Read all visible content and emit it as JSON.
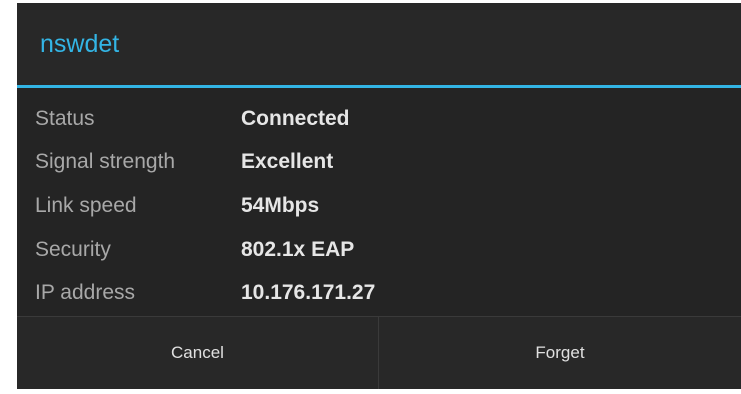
{
  "dialog": {
    "title": "nswdet",
    "details": [
      {
        "label": "Status",
        "value": "Connected"
      },
      {
        "label": "Signal strength",
        "value": "Excellent"
      },
      {
        "label": "Link speed",
        "value": "54Mbps"
      },
      {
        "label": "Security",
        "value": "802.1x EAP"
      },
      {
        "label": "IP address",
        "value": "10.176.171.27"
      }
    ],
    "buttons": {
      "cancel_label": "Cancel",
      "forget_label": "Forget"
    }
  },
  "colors": {
    "accent": "#33b5e5",
    "background": "#282828",
    "label_text": "#a8a8a8",
    "value_text": "#e6e6e6"
  }
}
